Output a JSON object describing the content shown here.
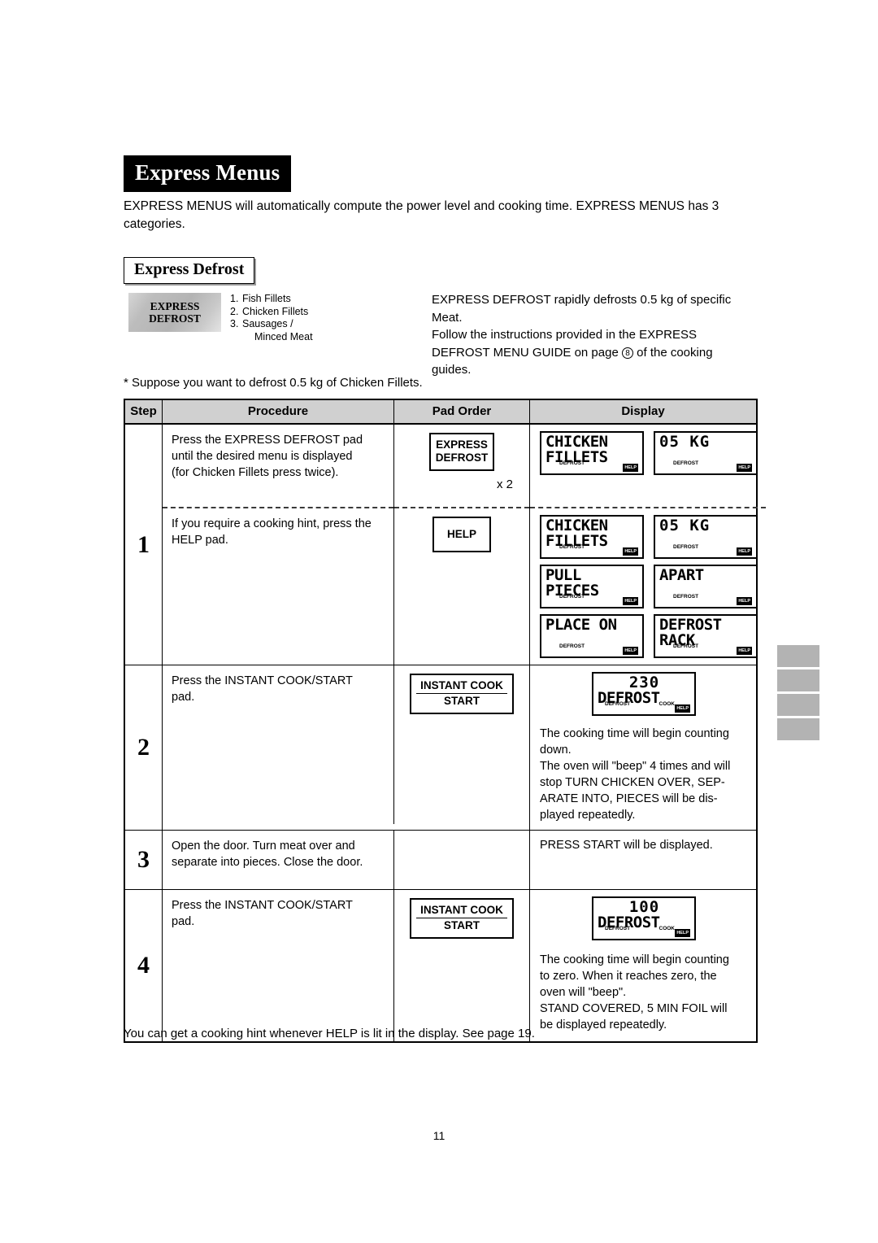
{
  "document": {
    "title": "Express Menus",
    "page_number": "11"
  },
  "intro": {
    "paragraph": "EXPRESS MENUS will automatically compute the power level and cooking time. EXPRESS MENUS has 3 categories."
  },
  "section": {
    "heading": "Express Defrost",
    "pad": {
      "line1": "EXPRESS",
      "line2": "DEFROST"
    },
    "menu_items": [
      {
        "num": "1.",
        "label": "Fish Fillets"
      },
      {
        "num": "2.",
        "label": "Chicken Fillets"
      },
      {
        "num": "3.",
        "label": "Sausages /"
      },
      {
        "num": "",
        "label": "Minced Meat",
        "indent": true
      }
    ],
    "description": {
      "line1": "EXPRESS DEFROST rapidly defrosts 0.5 kg of specific",
      "line2": "Meat.",
      "line3": "Follow the instructions provided in the EXPRESS",
      "line4_a": "DEFROST MENU GUIDE on page",
      "line4_circle": "8",
      "line4_b": "of the cooking",
      "line5": "guides."
    },
    "suppose": "* Suppose you want to defrost 0.5 kg of Chicken Fillets."
  },
  "table": {
    "headers": {
      "step": "Step",
      "procedure": "Procedure",
      "pad_order": "Pad Order",
      "display": "Display"
    },
    "rows": [
      {
        "step": "1",
        "sub_a": {
          "procedure_l1": "Press the EXPRESS DEFROST pad",
          "procedure_l2": "until the desired menu is displayed",
          "procedure_l3": "(for Chicken Fillets press twice).",
          "pad": {
            "line1": "EXPRESS",
            "line2": "DEFROST",
            "split": false
          },
          "pad_count": "x 2",
          "displays": [
            {
              "l1": "CHICKEN",
              "l2": "FILLETS",
              "defrost": "DEFROST",
              "cook": "",
              "help": "HELP"
            },
            {
              "l1": "05 KG",
              "l2": "",
              "defrost": "DEFROST",
              "cook": "",
              "help": "HELP"
            }
          ]
        },
        "sub_b": {
          "procedure_l1": "If you require a cooking hint, press the",
          "procedure_l2": "HELP pad.",
          "pad": {
            "line1": "HELP",
            "line2": "",
            "split": false
          },
          "displays_rows": [
            [
              {
                "l1": "CHICKEN",
                "l2": "FILLETS",
                "defrost": "DEFROST",
                "cook": "",
                "help": "HELP"
              },
              {
                "l1": "05 KG",
                "l2": "",
                "defrost": "DEFROST",
                "cook": "",
                "help": "HELP"
              }
            ],
            [
              {
                "l1": "PULL",
                "l2": "PIECES",
                "defrost": "DEFROST",
                "cook": "",
                "help": "HELP"
              },
              {
                "l1": "APART",
                "l2": "",
                "defrost": "DEFROST",
                "cook": "",
                "help": "HELP"
              }
            ],
            [
              {
                "l1": "PLACE ON",
                "l2": "",
                "defrost": "DEFROST",
                "cook": "",
                "help": "HELP"
              },
              {
                "l1": "DEFROST",
                "l2": "RACK",
                "defrost": "DEFROST",
                "cook": "",
                "help": "HELP"
              }
            ]
          ]
        }
      },
      {
        "step": "2",
        "procedure_l1": "Press the INSTANT COOK/START",
        "procedure_l2": "pad.",
        "pad": {
          "line1": "INSTANT COOK",
          "line2": "START",
          "split": true
        },
        "display_lcd": {
          "l1": "230",
          "l2": "DEFROST",
          "defrost": "DEFROST",
          "cook": "COOK",
          "help": "HELP",
          "numeric_first": true
        },
        "display_text_l1": "The cooking time will begin counting",
        "display_text_l2": "down.",
        "display_text_l3": "The oven will \"beep\" 4 times and will",
        "display_text_l4": "stop TURN CHICKEN OVER, SEP-",
        "display_text_l5": "ARATE INTO, PIECES will be dis-",
        "display_text_l6": "played repeatedly."
      },
      {
        "step": "3",
        "procedure_l1": "Open the door. Turn meat over and",
        "procedure_l2": "separate into pieces. Close the door.",
        "pad": null,
        "display_text_l1": "PRESS START will be displayed."
      },
      {
        "step": "4",
        "procedure_l1": "Press the INSTANT COOK/START",
        "procedure_l2": "pad.",
        "pad": {
          "line1": "INSTANT COOK",
          "line2": "START",
          "split": true
        },
        "display_lcd": {
          "l1": "100",
          "l2": "DEFROST",
          "defrost": "DEFROST",
          "cook": "COOK",
          "help": "HELP",
          "numeric_first": true
        },
        "display_text_l1": "The cooking time will begin counting",
        "display_text_l2": "to zero. When it reaches zero, the",
        "display_text_l3": "oven will \"beep\".",
        "display_text_l4": "STAND COVERED, 5 MIN FOIL will",
        "display_text_l5": "be displayed repeatedly."
      }
    ]
  },
  "footer": {
    "note": "You can get a cooking hint whenever HELP is lit in the display. See page 19."
  },
  "colors": {
    "header_fill": "#d0d0d0",
    "tab_gray": "#b3b3b3",
    "pad_gray": "#bdbdbd",
    "ink": "#000000"
  }
}
